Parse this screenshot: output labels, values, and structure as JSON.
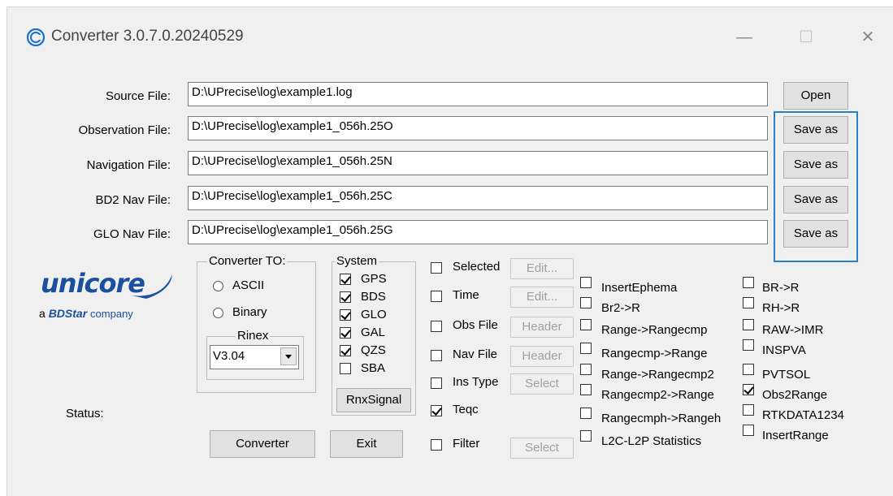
{
  "window": {
    "title": "Converter  3.0.7.0.20240529",
    "minimize_glyph": "—",
    "maximize_glyph": "☐",
    "close_glyph": "✕"
  },
  "files": [
    {
      "label": "Source File:",
      "value": "D:\\UPrecise\\log\\example1.log",
      "button": "Open"
    },
    {
      "label": "Observation File:",
      "value": "D:\\UPrecise\\log\\example1_056h.25O",
      "button": "Save as"
    },
    {
      "label": "Navigation File:",
      "value": "D:\\UPrecise\\log\\example1_056h.25N",
      "button": "Save as"
    },
    {
      "label": "BD2 Nav File:",
      "value": "D:\\UPrecise\\log\\example1_056h.25C",
      "button": "Save as"
    },
    {
      "label": "GLO Nav File:",
      "value": "D:\\UPrecise\\log\\example1_056h.25G",
      "button": "Save as"
    }
  ],
  "logo": {
    "brand": "unicore",
    "tagline_prefix": "a",
    "tagline_brand": "BDStar",
    "tagline_suffix": "company"
  },
  "converter_to": {
    "legend": "Converter TO:",
    "options": [
      "ASCII",
      "Binary"
    ],
    "rinex": {
      "legend": "Rinex",
      "selected": "V3.04"
    }
  },
  "system": {
    "legend": "System",
    "items": [
      {
        "label": "GPS",
        "checked": true
      },
      {
        "label": "BDS",
        "checked": true
      },
      {
        "label": "GLO",
        "checked": true
      },
      {
        "label": "GAL",
        "checked": true
      },
      {
        "label": "QZS",
        "checked": true
      },
      {
        "label": "SBA",
        "checked": false
      }
    ],
    "rnx_button": "RnxSignal"
  },
  "options": [
    {
      "label": "Selected",
      "checked": false,
      "button": "Edit..."
    },
    {
      "label": "Time",
      "checked": false,
      "button": "Edit..."
    },
    {
      "label": "Obs File",
      "checked": false,
      "button": "Header"
    },
    {
      "label": "Nav File",
      "checked": false,
      "button": "Header"
    },
    {
      "label": "Ins Type",
      "checked": false,
      "button": "Select"
    },
    {
      "label": "Teqc",
      "checked": true,
      "button": ""
    },
    {
      "label": "Filter",
      "checked": false,
      "button": "Select"
    }
  ],
  "col1": [
    {
      "label": "InsertEphema",
      "checked": false
    },
    {
      "label": "Br2->R",
      "checked": false
    },
    {
      "label": "Range->Rangecmp",
      "checked": false
    },
    {
      "label": "Rangecmp->Range",
      "checked": false
    },
    {
      "label": "Range->Rangecmp2",
      "checked": false
    },
    {
      "label": "Rangecmp2->Range",
      "checked": false
    },
    {
      "label": "Rangecmph->Rangeh",
      "checked": false
    },
    {
      "label": "L2C-L2P Statistics",
      "checked": false
    }
  ],
  "col2": [
    {
      "label": "BR->R",
      "checked": false
    },
    {
      "label": "RH->R",
      "checked": false
    },
    {
      "label": "RAW->IMR",
      "checked": false
    },
    {
      "label": "INSPVA",
      "checked": false
    },
    {
      "label": "PVTSOL",
      "checked": false
    },
    {
      "label": "Obs2Range",
      "checked": true
    },
    {
      "label": "RTKDATA1234",
      "checked": false
    },
    {
      "label": "InsertRange",
      "checked": false
    }
  ],
  "status_label": "Status:",
  "actions": {
    "converter": "Converter",
    "exit": "Exit"
  },
  "colors": {
    "brand_blue": "#1b4fa0",
    "highlight": "#2a7fc9"
  }
}
